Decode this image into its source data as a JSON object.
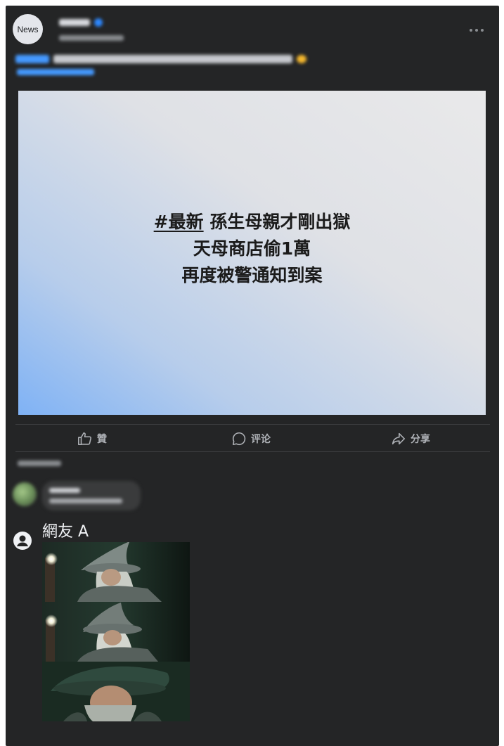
{
  "post": {
    "avatar_label": "News",
    "headline_hashtag": "#最新",
    "headline_line1_rest": " 孫生母親才剛出獄",
    "headline_line2": "天母商店偷1萬",
    "headline_line3": "再度被警通知到案"
  },
  "actions": {
    "like_label": "贊",
    "comment_label": "评论",
    "share_label": "分享"
  },
  "comment": {
    "author": "網友 A"
  },
  "colors": {
    "card_bg": "#242526",
    "accent_blue": "#2d88ff",
    "action_text": "#b0b3b8"
  }
}
